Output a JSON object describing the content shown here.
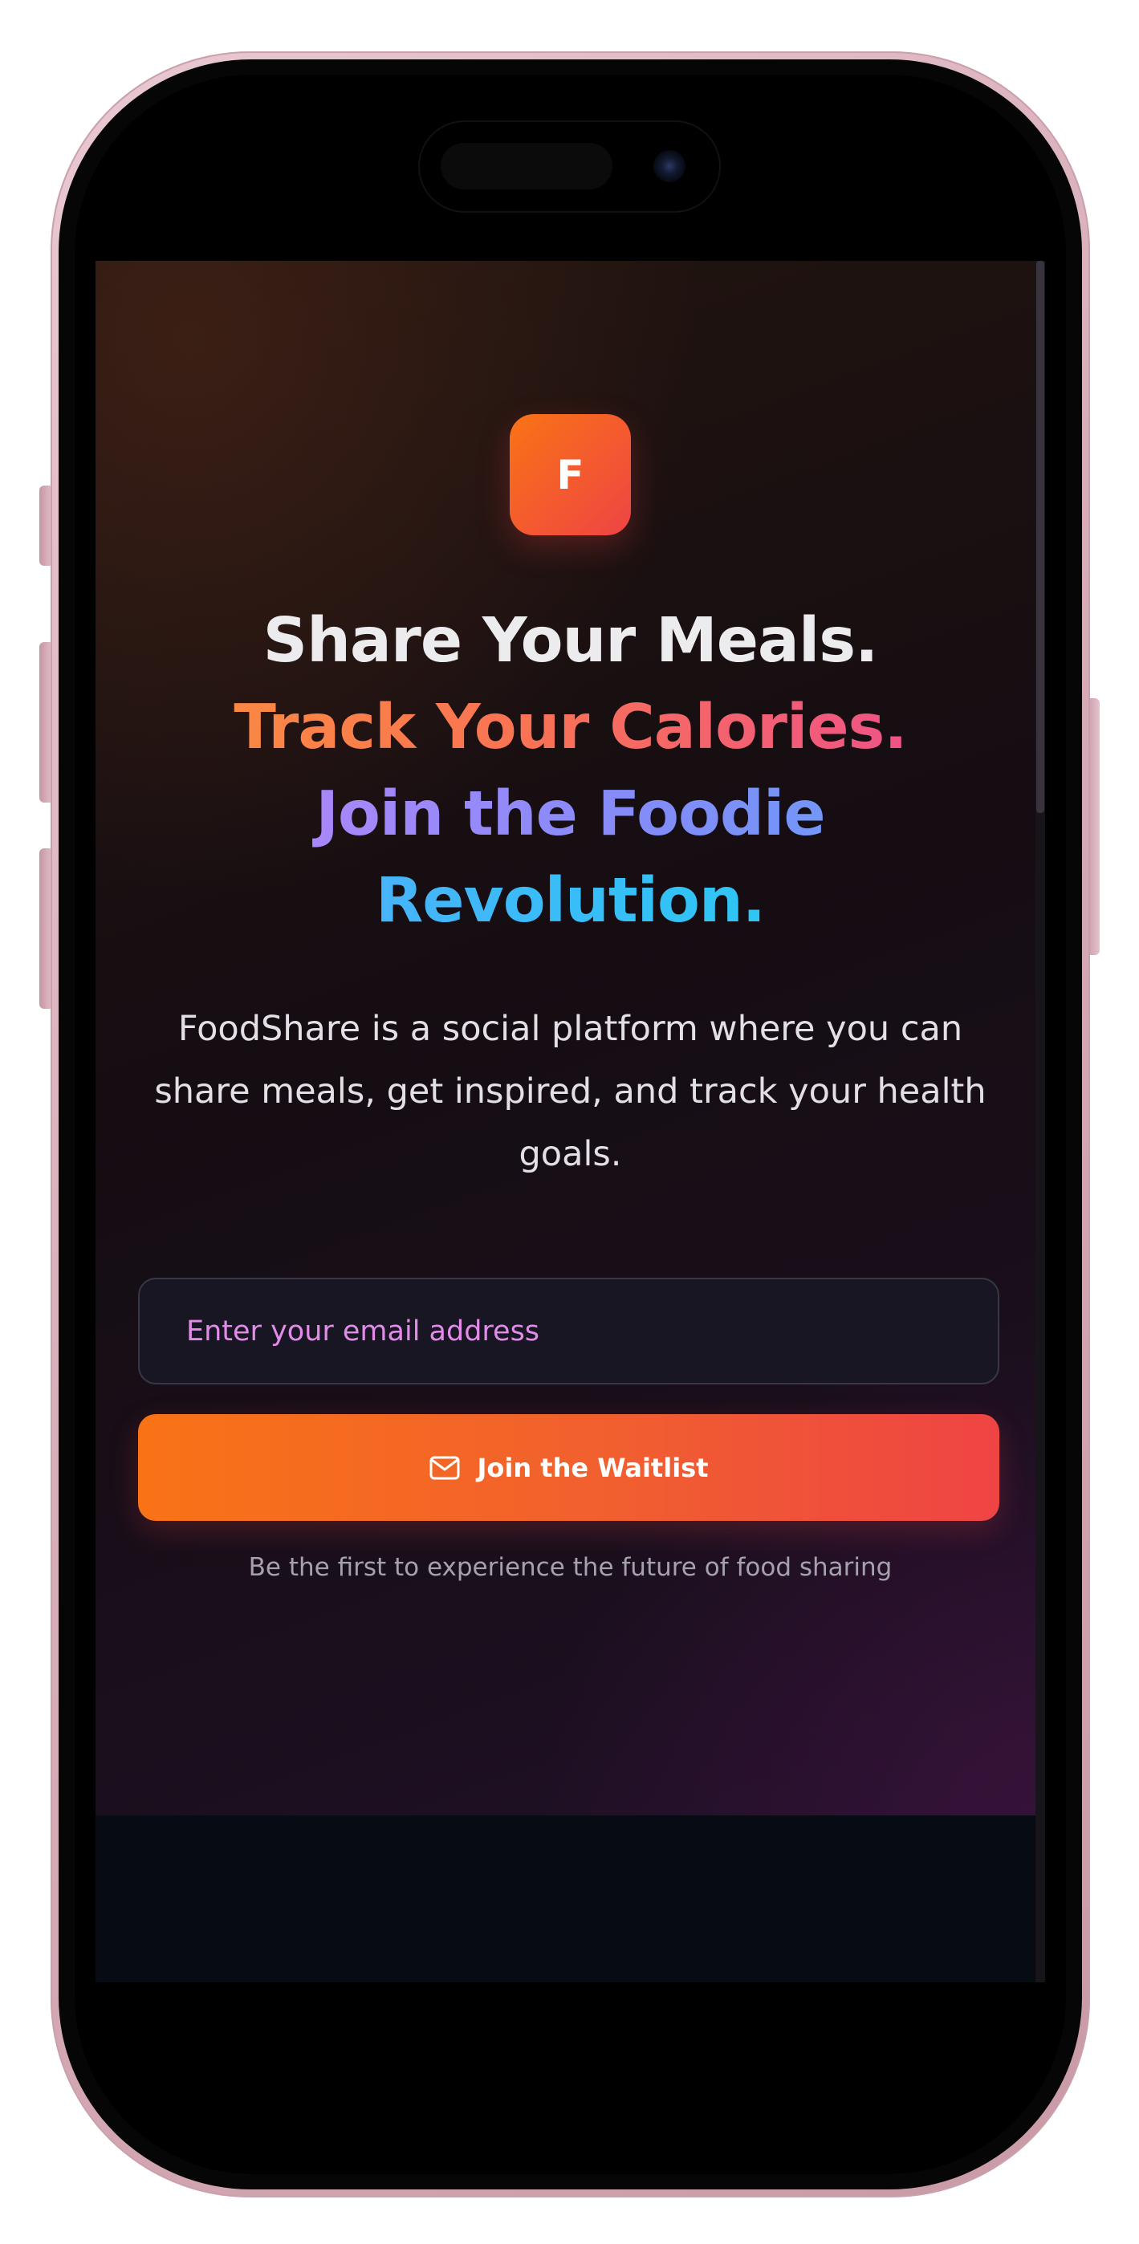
{
  "brand": {
    "logo_letter": "F",
    "accent_start": "#f97316",
    "accent_end": "#ef4444"
  },
  "hero": {
    "headline": {
      "line1": "Share Your Meals.",
      "line2": "Track Your Calories.",
      "line3": "Join the Foodie",
      "line4": "Revolution."
    },
    "description": "FoodShare is a social platform where you can share meals, get inspired, and track your health goals."
  },
  "signup": {
    "email_placeholder": "Enter your email address",
    "email_value": "",
    "button_label": "Join the Waitlist",
    "button_icon": "mail-icon",
    "tagline": "Be the first to experience the future of food sharing"
  }
}
